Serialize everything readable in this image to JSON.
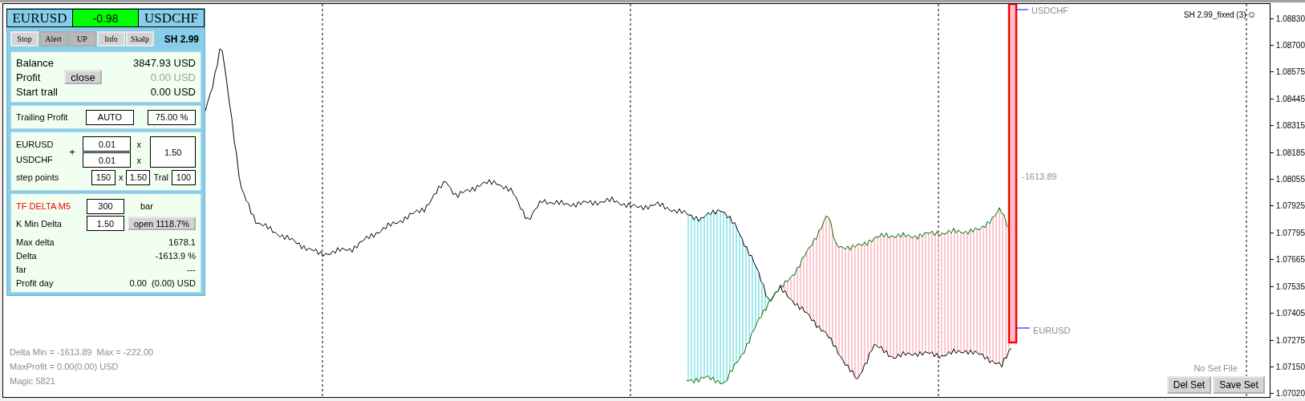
{
  "pair_header": [
    {
      "kind": "symbol",
      "label": "EURUSD"
    },
    {
      "kind": "value",
      "label": "-0.98"
    },
    {
      "kind": "symbol",
      "label": "USDCHF"
    }
  ],
  "tabs": [
    {
      "label": "Stop",
      "pressed": false
    },
    {
      "label": "Alert",
      "pressed": true
    },
    {
      "label": "UP",
      "pressed": true
    },
    {
      "label": "Info",
      "pressed": false
    },
    {
      "label": "Skalp",
      "pressed": false
    }
  ],
  "version": "SH 2.99",
  "account": {
    "balance_label": "Balance",
    "balance": "3847.93 USD",
    "profit_label": "Profit",
    "profit": "0.00 USD",
    "profit_muted": true,
    "close_button": "close",
    "trall_label": "Start trall",
    "trall": "0.00 USD"
  },
  "trailing": {
    "label": "Trailing Profit",
    "mode": "AUTO",
    "percent": "75.00 %"
  },
  "lots": {
    "symbol_1": "EURUSD",
    "symbol_2": "USDCHF",
    "plus": "+",
    "lot_1": "0.01",
    "lot_2": "0.01",
    "times_1": "x",
    "times_2": "x",
    "multiplier": "1.50",
    "step_label": "step points",
    "step": "150",
    "times_3": "x",
    "step_mult": "1.50",
    "tral_label": "Tral",
    "tral": "100"
  },
  "delta": {
    "tf_label": "TF DELTA M5",
    "bars": "300",
    "bars_unit": "bar",
    "k_label": "K Min Delta",
    "k": "1.50",
    "open_button": "open 1118.7%",
    "stats": [
      {
        "label": "Max delta",
        "value": "1678.1"
      },
      {
        "label": "Delta",
        "value": "-1613.9 %"
      },
      {
        "label": "far",
        "value": "---"
      },
      {
        "label": "Profit day",
        "value": "0.00  (0.00) USD"
      }
    ]
  },
  "chart": {
    "indicator_name": "SH 2.99_fixed (3)",
    "smiley": "☺",
    "top_symbol": "USDCHF",
    "delta_value": "-1613.89",
    "bottom_symbol": "EURUSD",
    "set_status": "No Set File",
    "del_button": "Del Set",
    "save_button": "Save Set",
    "info_lines": [
      "Delta Min = -1613.89  Max = -222.00",
      "MaxProfit = 0.00(0.00) USD",
      "Magic 5821"
    ]
  },
  "price_axis": [
    "1.08830",
    "1.08700",
    "1.08575",
    "1.08445",
    "1.08315",
    "1.08185",
    "1.08055",
    "1.07925",
    "1.07795",
    "1.07665",
    "1.07535",
    "1.07405",
    "1.07275",
    "1.07150",
    "1.07020"
  ]
}
